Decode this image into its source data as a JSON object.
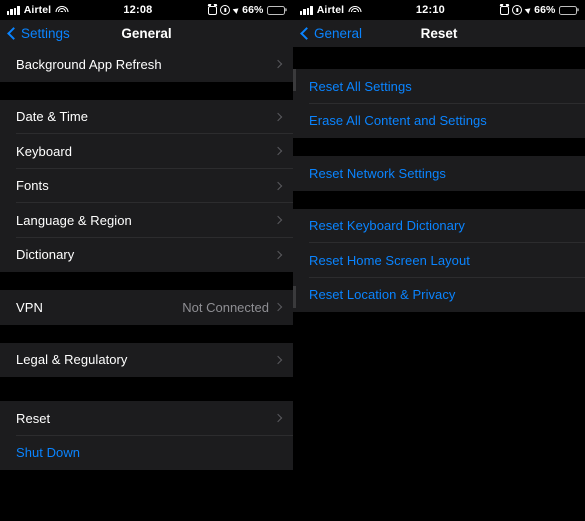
{
  "left": {
    "status": {
      "carrier": "Airtel",
      "time": "12:08",
      "battery_pct": "66%",
      "signal_icon": "cellular-bars-icon",
      "wifi_icon": "wifi-icon",
      "alarm_icon": "alarm-clock-icon",
      "lock_icon": "rotation-lock-icon",
      "location_icon": "location-arrow-icon",
      "battery_icon": "battery-icon"
    },
    "nav": {
      "back_label": "Settings",
      "title": "General",
      "back_icon": "chevron-left-icon"
    },
    "sections": [
      {
        "rows": [
          {
            "label": "Background App Refresh",
            "chevron": true
          }
        ]
      },
      {
        "rows": [
          {
            "label": "Date & Time",
            "chevron": true
          },
          {
            "label": "Keyboard",
            "chevron": true
          },
          {
            "label": "Fonts",
            "chevron": true
          },
          {
            "label": "Language & Region",
            "chevron": true
          },
          {
            "label": "Dictionary",
            "chevron": true
          }
        ]
      },
      {
        "rows": [
          {
            "label": "VPN",
            "value": "Not Connected",
            "chevron": true
          }
        ]
      },
      {
        "rows": [
          {
            "label": "Legal & Regulatory",
            "chevron": true
          }
        ]
      },
      {
        "rows": [
          {
            "label": "Reset",
            "chevron": true
          },
          {
            "label": "Shut Down",
            "blue": true,
            "chevron": false
          }
        ]
      }
    ]
  },
  "right": {
    "status": {
      "carrier": "Airtel",
      "time": "12:10",
      "battery_pct": "66%",
      "signal_icon": "cellular-bars-icon",
      "wifi_icon": "wifi-icon",
      "alarm_icon": "alarm-clock-icon",
      "lock_icon": "rotation-lock-icon",
      "location_icon": "location-arrow-icon",
      "battery_icon": "battery-icon"
    },
    "nav": {
      "back_label": "General",
      "title": "Reset",
      "back_icon": "chevron-left-icon"
    },
    "sections": [
      {
        "rows": [
          {
            "label": "Reset All Settings",
            "blue": true
          },
          {
            "label": "Erase All Content and Settings",
            "blue": true
          }
        ]
      },
      {
        "rows": [
          {
            "label": "Reset Network Settings",
            "blue": true
          }
        ]
      },
      {
        "rows": [
          {
            "label": "Reset Keyboard Dictionary",
            "blue": true
          },
          {
            "label": "Reset Home Screen Layout",
            "blue": true
          },
          {
            "label": "Reset Location & Privacy",
            "blue": true
          }
        ]
      }
    ]
  },
  "colors": {
    "accent": "#0a84ff",
    "row_bg": "#1c1c1e",
    "page_bg": "#000000",
    "separator": "#2c2c2e",
    "secondary_text": "#8e8e93"
  }
}
